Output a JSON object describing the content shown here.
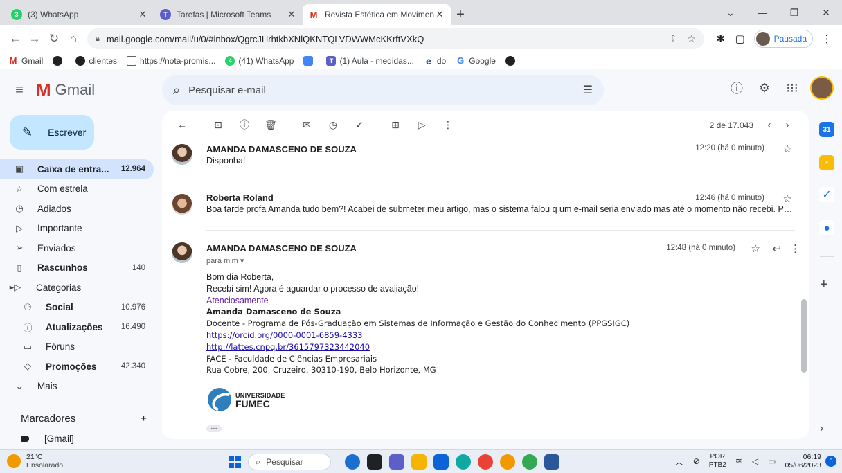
{
  "browser": {
    "tabs": [
      {
        "title": "(3) WhatsApp",
        "icon": "whatsapp-icon",
        "color": "#25d366",
        "glyph": "3"
      },
      {
        "title": "Tarefas | Microsoft Teams",
        "icon": "teams-icon",
        "color": "#5b5fc7",
        "glyph": "T"
      },
      {
        "title": "Revista Estética em Movimento -",
        "icon": "gmail-icon",
        "color": "#d93025",
        "glyph": "M"
      }
    ],
    "url": "mail.google.com/mail/u/0/#inbox/QgrcJHrhtkbXNlQKNTQLVDWWMcKKrftVXkQ",
    "profile_status": "Pausada",
    "bookmarks": [
      {
        "label": "Gmail",
        "color": "#d93025",
        "glyph": "M"
      },
      {
        "label": "",
        "color": "#202124",
        "glyph": "●"
      },
      {
        "label": "clientes",
        "color": "#202124",
        "glyph": "●"
      },
      {
        "label": "https://nota-promis...",
        "color": "#5f6368",
        "glyph": "▤"
      },
      {
        "label": "(41) WhatsApp",
        "color": "#25d366",
        "glyph": "4"
      },
      {
        "label": "",
        "color": "#4285f4",
        "glyph": "◆"
      },
      {
        "label": "(1) Aula - medidas...",
        "color": "#5b5fc7",
        "glyph": "T"
      },
      {
        "label": "do",
        "color": "#1a4ba0",
        "glyph": "e"
      },
      {
        "label": "Google",
        "color": "#4285f4",
        "glyph": "G"
      },
      {
        "label": "",
        "color": "#202124",
        "glyph": "●"
      }
    ]
  },
  "gmail": {
    "logo_text": "Gmail",
    "search_placeholder": "Pesquisar e-mail",
    "compose_label": "Escrever",
    "nav": [
      {
        "label": "Caixa de entra...",
        "count": "12.964",
        "icon": "inbox-icon",
        "glyph": "▣",
        "active": true
      },
      {
        "label": "Com estrela",
        "count": "",
        "icon": "star-icon",
        "glyph": "☆"
      },
      {
        "label": "Adiados",
        "count": "",
        "icon": "clock-icon",
        "glyph": "◷"
      },
      {
        "label": "Importante",
        "count": "",
        "icon": "important-icon",
        "glyph": "⊳"
      },
      {
        "label": "Enviados",
        "count": "",
        "icon": "send-icon",
        "glyph": "▷"
      },
      {
        "label": "Rascunhos",
        "count": "140",
        "icon": "draft-icon",
        "glyph": "▯",
        "bold": true
      },
      {
        "label": "Categorias",
        "count": "",
        "icon": "label-icon",
        "glyph": "▸◇"
      },
      {
        "label": "Social",
        "count": "10.976",
        "icon": "social-icon",
        "glyph": "⚇",
        "bold": true,
        "sub": true
      },
      {
        "label": "Atualizações",
        "count": "16.490",
        "icon": "info-icon",
        "glyph": "ⓘ",
        "bold": true,
        "sub": true
      },
      {
        "label": "Fóruns",
        "count": "",
        "icon": "forum-icon",
        "glyph": "▭",
        "sub": true
      },
      {
        "label": "Promoções",
        "count": "42.340",
        "icon": "tag-icon",
        "glyph": "◇",
        "bold": true,
        "sub": true
      },
      {
        "label": "Mais",
        "count": "",
        "icon": "chevron-down-icon",
        "glyph": "⌄"
      }
    ],
    "markers_label": "Marcadores",
    "label_gmail": "[Gmail]",
    "pager": "2 de 17.043"
  },
  "thread": {
    "messages": [
      {
        "sender": "AMANDA DAMASCENO DE SOUZA",
        "time": "12:20 (há 0 minuto)",
        "snippet": "Disponha!"
      },
      {
        "sender": "Roberta Roland",
        "time": "12:46 (há 0 minuto)",
        "snippet": "Boa tarde profa Amanda tudo bem?! Acabei de submeter meu artigo, mas o sistema falou q um e-mail seria enviado mas até o momento não recebi. Poderia verificar?"
      },
      {
        "sender": "AMANDA DAMASCENO DE SOUZA",
        "time": "12:48 (há 0 minuto)",
        "to": "para mim"
      }
    ],
    "body": {
      "greeting": "Bom dia Roberta,",
      "line1": "Recebi sim! Agora é aguardar o processo de avaliação!",
      "closing": "Atenciosamente",
      "sig_name": "Amanda Damasceno de Souza",
      "sig_role": "Docente - Programa de Pós-Graduação em Sistemas de Informação e Gestão do Conhecimento (PPGSIGC)",
      "orcid": "https://orcid.org/0000-0001-6859-4333",
      "lattes": "http://lattes.cnpq.br/3615797323442040",
      "faculty": "FACE - Faculdade de Ciências Empresariais",
      "address": "Rua Cobre, 200, Cruzeiro, 30310-190, Belo Horizonte, MG",
      "logo_line1": "UNIVERSIDADE",
      "logo_line2": "FUMEC"
    }
  },
  "taskbar": {
    "temp": "21°C",
    "weather": "Ensolarado",
    "search": "Pesquisar",
    "lang1": "POR",
    "lang2": "PTB2",
    "time": "06:19",
    "date": "05/06/2023",
    "notifications": "5"
  }
}
